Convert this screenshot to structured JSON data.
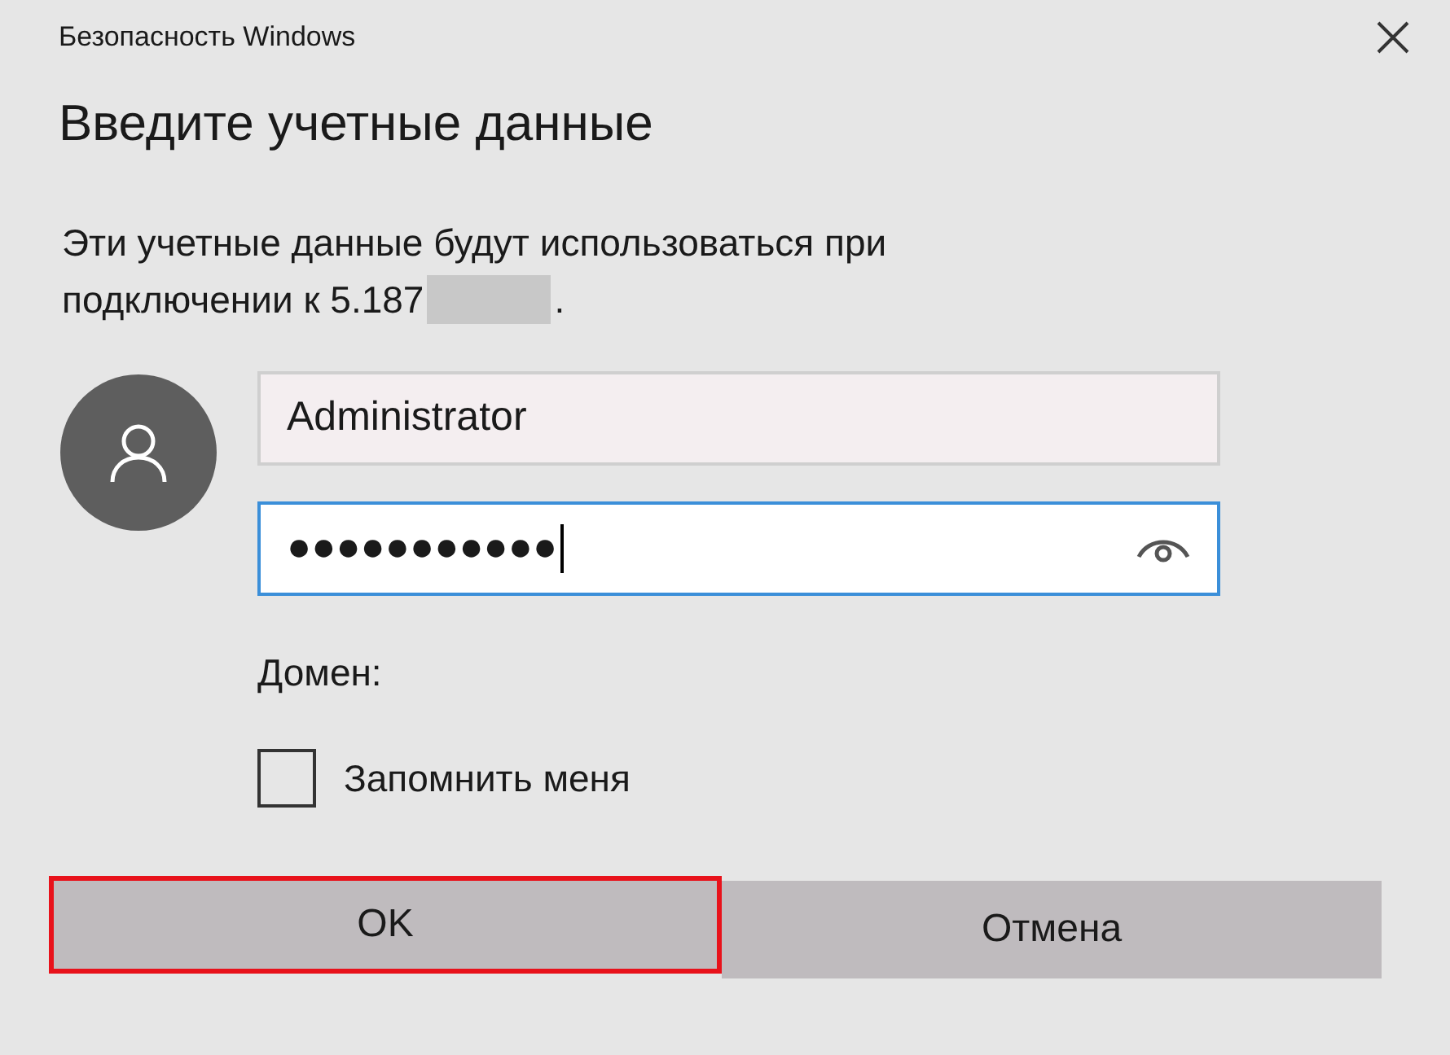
{
  "window": {
    "title": "Безопасность Windows"
  },
  "heading": "Введите учетные данные",
  "message": {
    "lines": [
      "Эти учетные данные будут использоваться при",
      "подключении к 5.187"
    ],
    "redacted": true,
    "end": "."
  },
  "username": {
    "value": "Administrator",
    "focused": false
  },
  "password": {
    "value": "●●●●●●●●●●●",
    "focused": true
  },
  "domain_label": "Домен:",
  "remember": {
    "label": "Запомнить меня",
    "checked": false
  },
  "buttons": [
    {
      "label": "OK",
      "highlighted": true
    },
    {
      "label": "Отмена",
      "highlighted": false
    }
  ]
}
